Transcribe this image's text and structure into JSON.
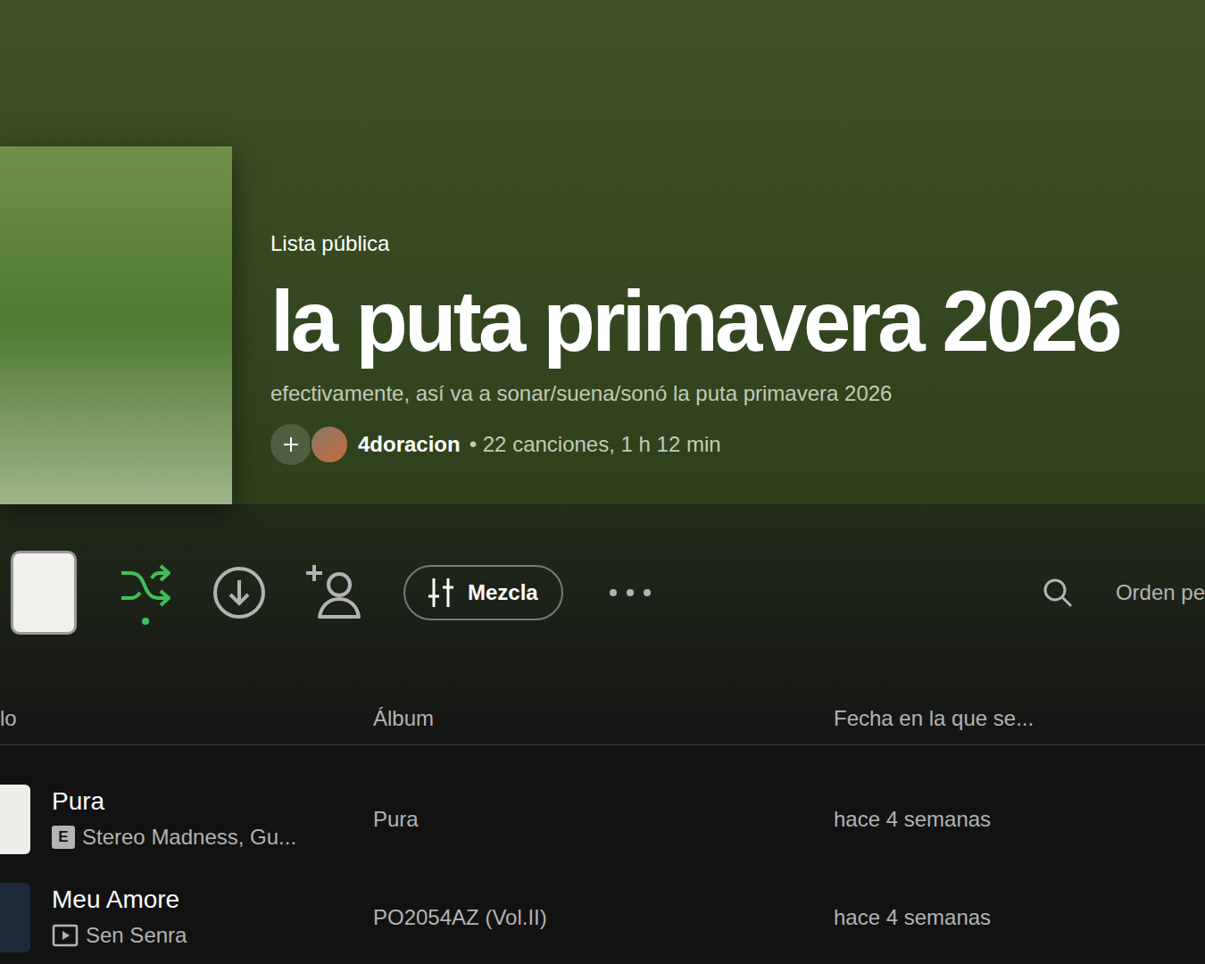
{
  "playlist": {
    "type": "Lista pública",
    "title": "la puta primavera 2026",
    "description": "efectivamente, así va a sonar/suena/sonó la puta primavera 2026",
    "owner": "4doracion",
    "meta": "• 22 canciones, 1 h 12 min"
  },
  "toolbar": {
    "shuffle": {
      "on": true
    },
    "mix": "Mezcla",
    "sort": "Orden pe"
  },
  "table": {
    "columns": [
      "lo",
      "Álbum",
      "Fecha en la que se..."
    ],
    "rows": [
      {
        "title": "Pura",
        "artists": "Stereo Madness, Gu...",
        "kind": "explicit",
        "badge": "E",
        "album": "Pura",
        "added": "hace 4 semanas",
        "color": "#eeeeea"
      },
      {
        "title": "Meu Amore",
        "artists": "Sen Senra",
        "kind": "video",
        "badge": "",
        "album": "PO2054AZ (Vol.II)",
        "added": "hace 4 semanas",
        "color": "#1c2a3a"
      }
    ]
  }
}
